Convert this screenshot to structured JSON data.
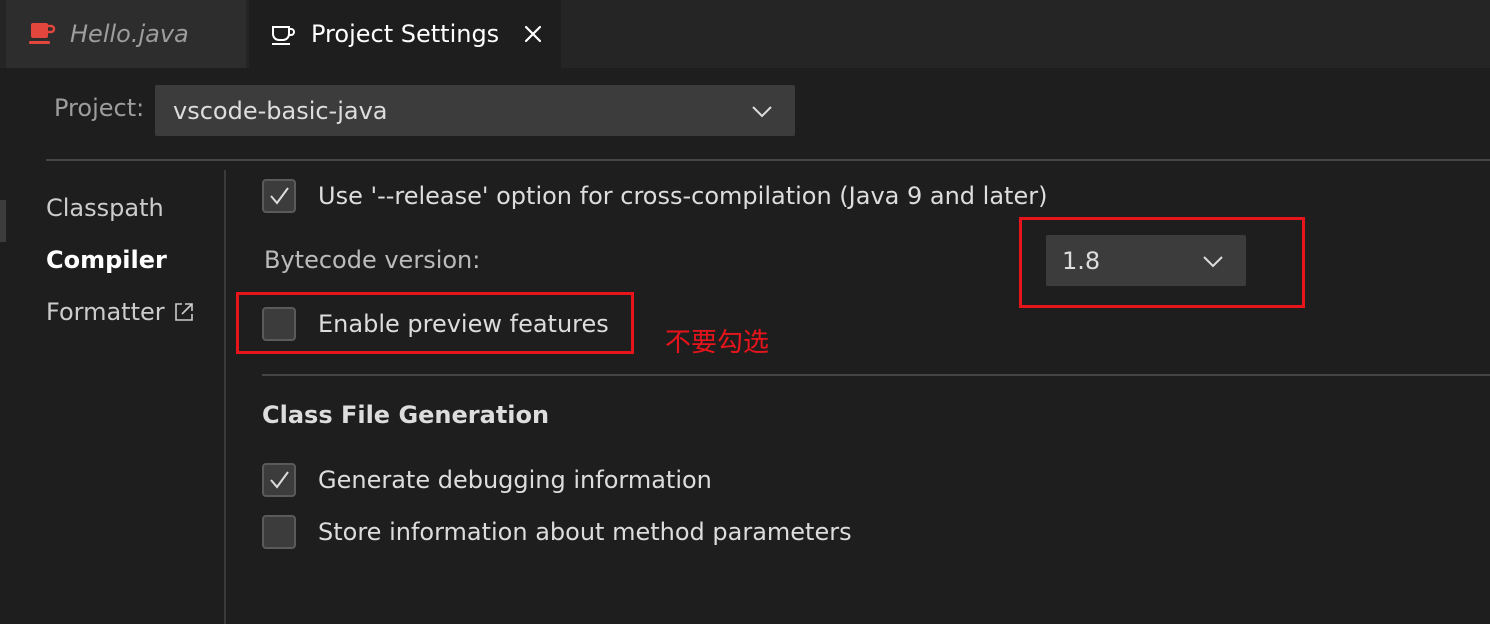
{
  "tabs": [
    {
      "label": "Hello.java",
      "icon": "java-file-icon",
      "active": false
    },
    {
      "label": "Project Settings",
      "icon": "coffee-cup-icon",
      "active": true
    }
  ],
  "project": {
    "label": "Project:",
    "selected": "vscode-basic-java"
  },
  "sidebar": {
    "items": [
      {
        "label": "Classpath",
        "active": false
      },
      {
        "label": "Compiler",
        "active": true
      },
      {
        "label": "Formatter",
        "active": false,
        "icon": "external-link-icon"
      }
    ]
  },
  "compiler": {
    "release_option": {
      "label": "Use '--release' option for cross-compilation (Java 9 and later)",
      "checked": true
    },
    "bytecode_label": "Bytecode version:",
    "bytecode_value": "1.8",
    "preview": {
      "label": "Enable preview features",
      "checked": false
    }
  },
  "class_file": {
    "title": "Class File Generation",
    "debug": {
      "label": "Generate debugging information",
      "checked": true
    },
    "params": {
      "label": "Store information about method parameters",
      "checked": false
    }
  },
  "annotation": {
    "text": "不要勾选",
    "color": "#e8141b"
  },
  "colors": {
    "background": "#1e1e1e",
    "tabbar": "#252526",
    "input": "#3c3c3c",
    "java_icon": "#e2463c",
    "annotation": "#e8141b"
  }
}
